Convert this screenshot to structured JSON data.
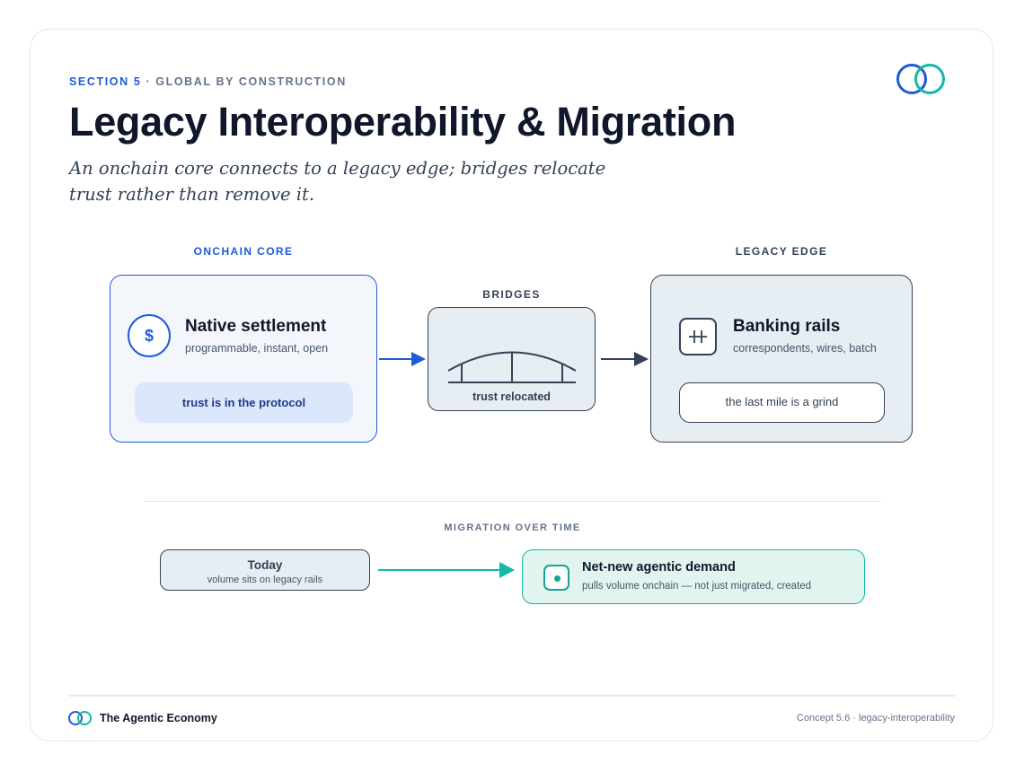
{
  "header": {
    "section": "SECTION 5",
    "section_rest": " · GLOBAL BY CONSTRUCTION",
    "title": "Legacy Interoperability & Migration",
    "subtitle_line1": "An onchain core connects to a legacy edge; bridges relocate",
    "subtitle_line2": "trust rather than remove it."
  },
  "onchain": {
    "label": "ONCHAIN CORE",
    "icon": "$",
    "title": "Native settlement",
    "sub": "programmable, instant, open",
    "pill": "trust is in the protocol"
  },
  "bridges": {
    "label": "BRIDGES",
    "caption": "trust relocated"
  },
  "legacy": {
    "label": "LEGACY EDGE",
    "title": "Banking rails",
    "sub": "correspondents, wires, batch",
    "pill": "the last mile is a grind"
  },
  "migration": {
    "label": "MIGRATION OVER TIME",
    "today_title": "Today",
    "today_sub": "volume sits on legacy rails",
    "demand_title": "Net-new agentic demand",
    "demand_sub": "pulls volume onchain — not just migrated, created"
  },
  "footer": {
    "brand": "The Agentic Economy",
    "meta": "Concept 5.6 · legacy-interoperability"
  },
  "colors": {
    "accent_blue": "#1d5bd8",
    "accent_teal": "#14b8a6",
    "slate": "#334155"
  }
}
